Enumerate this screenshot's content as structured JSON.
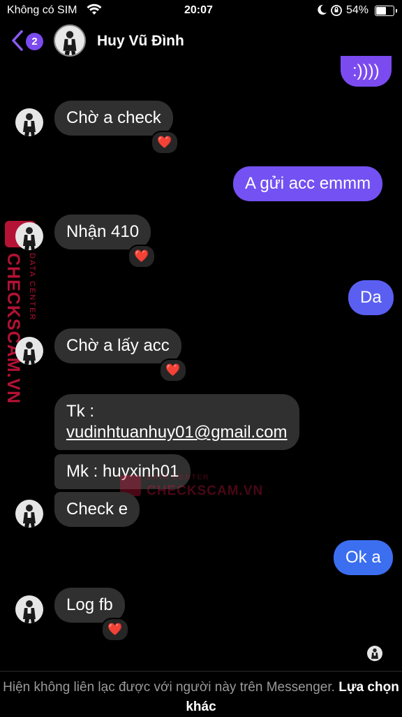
{
  "status_bar": {
    "carrier": "Không có SIM",
    "time": "20:07",
    "battery_percent": "54%",
    "battery_level": 0.54,
    "icons": [
      "wifi-icon",
      "moon-icon",
      "orientation-lock-icon",
      "battery-icon"
    ]
  },
  "header": {
    "back_badge": "2",
    "contact_name": "Huy Vũ Đình",
    "icons": [
      "chevron-left-icon"
    ]
  },
  "messages": [
    {
      "dir": "out",
      "text": ":))))"
    },
    {
      "dir": "in",
      "text": "Chờ a check",
      "reaction": "❤️"
    },
    {
      "dir": "out",
      "text": "A gửi acc emmm"
    },
    {
      "dir": "in",
      "text": "Nhận 410",
      "reaction": "❤️"
    },
    {
      "dir": "out",
      "text": "Da"
    },
    {
      "dir": "in",
      "text": "Chờ a lấy acc",
      "reaction": "❤️"
    },
    {
      "dir": "in",
      "text_prefix": "Tk :",
      "text_link": "vudinhtuanhuy01@gmail.com"
    },
    {
      "dir": "in",
      "text": "Mk : huyxinh01"
    },
    {
      "dir": "in",
      "text": "Check e"
    },
    {
      "dir": "out",
      "text": "Ok a"
    },
    {
      "dir": "in",
      "text": "Log fb",
      "reaction": "❤️"
    }
  ],
  "watermark": {
    "brand": "CHECKSCAM.VN",
    "tagline": "DATA CENTER"
  },
  "footer": {
    "notice": "Hiện không liên lạc được với người này trên Messenger.",
    "alt_action": "Lựa chọn khác"
  },
  "colors": {
    "incoming_bubble": "#303030",
    "outgoing_purple": "#7b4bf0",
    "outgoing_blue": "#3b6ff0",
    "watermark_red": "#d3163e"
  }
}
